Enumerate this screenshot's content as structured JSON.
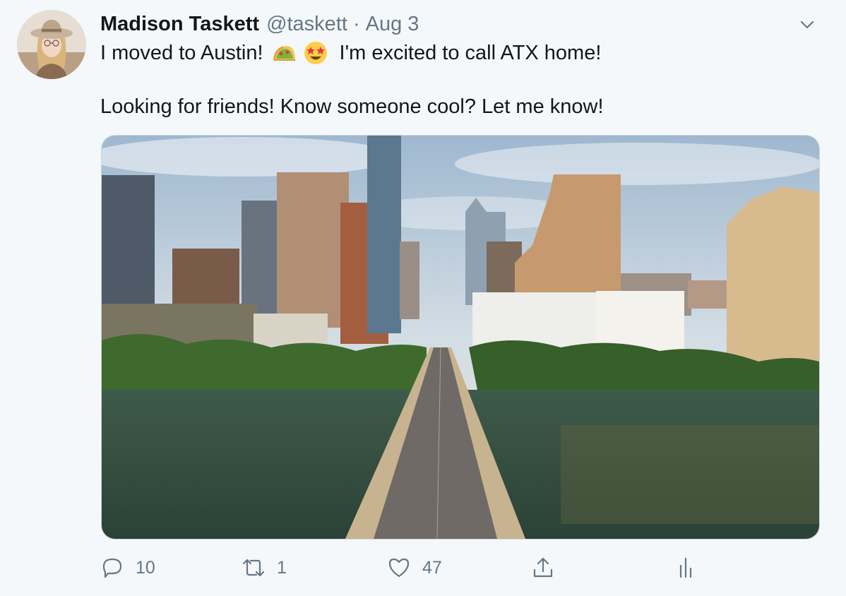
{
  "tweet": {
    "author_name": "Madison Taskett",
    "handle": "@taskett",
    "separator": "·",
    "timestamp": "Aug 3",
    "text_line1_part1": "I moved to Austin!",
    "text_line1_part2": "I'm excited to call ATX home!",
    "text_line2": "Looking for friends! Know someone cool? Let me know!",
    "emojis": [
      "taco-emoji",
      "star-struck-emoji"
    ],
    "media": {
      "description_icon": "photo",
      "subject": "austin-skyline-bridge-photo"
    }
  },
  "actions": {
    "reply_count": "10",
    "retweet_count": "1",
    "like_count": "47",
    "icons": [
      "reply-icon",
      "retweet-icon",
      "like-icon",
      "share-icon",
      "analytics-icon"
    ]
  },
  "colors": {
    "background": "#f5f8fa",
    "text": "#14171a",
    "secondary": "#657786",
    "border": "#ccd6dd"
  }
}
